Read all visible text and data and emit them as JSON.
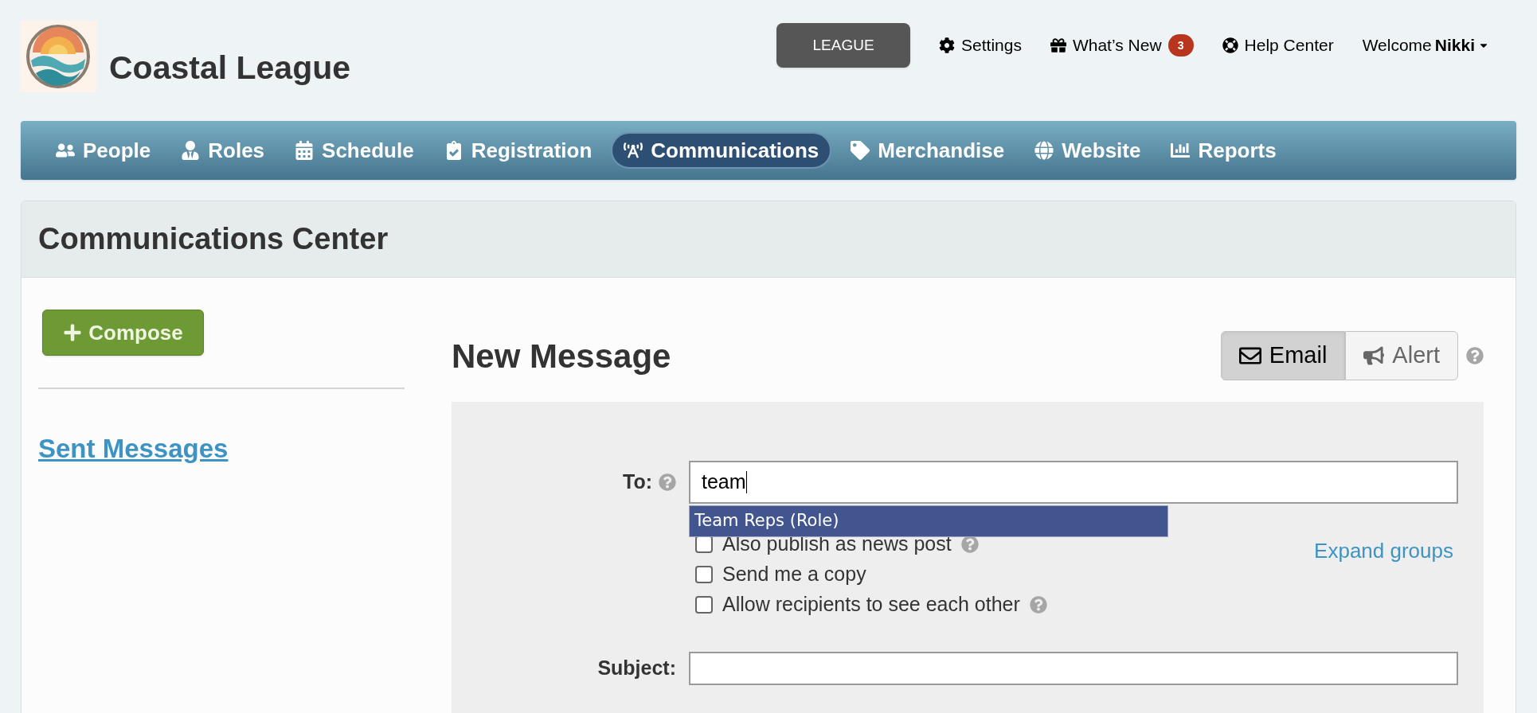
{
  "brand": {
    "name": "Coastal League"
  },
  "top_links": [
    {
      "kind": "button",
      "label": "LEAGUE"
    },
    {
      "kind": "settings",
      "label": "Settings"
    },
    {
      "kind": "gift",
      "label": "What’s New",
      "badge": "3"
    },
    {
      "kind": "help",
      "label": "Help Center"
    },
    {
      "kind": "user",
      "label": "Welcome",
      "user": "Nikki"
    }
  ],
  "nav": [
    {
      "kind": "people",
      "label": "People",
      "selected": false
    },
    {
      "kind": "roles",
      "label": "Roles",
      "selected": false
    },
    {
      "kind": "schedule",
      "label": "Schedule",
      "selected": false
    },
    {
      "kind": "registration",
      "label": "Registration",
      "selected": false
    },
    {
      "kind": "communications",
      "label": "Communications",
      "selected": true
    },
    {
      "kind": "merchandise",
      "label": "Merchandise",
      "selected": false
    },
    {
      "kind": "website",
      "label": "Website",
      "selected": false
    },
    {
      "kind": "reports",
      "label": "Reports",
      "selected": false
    }
  ],
  "panel": {
    "title": "Communications Center"
  },
  "sidebar": {
    "compose": "Compose",
    "links": [
      "Sent Messages"
    ]
  },
  "message": {
    "title": "New Message",
    "modes": [
      {
        "kind": "email",
        "label": "Email",
        "selected": true
      },
      {
        "kind": "alert",
        "label": "Alert",
        "selected": false
      }
    ],
    "to": {
      "label": "To:",
      "value": "team",
      "suggestions": [
        "Team Reps (Role)"
      ]
    },
    "expand_link": "Expand groups",
    "options": [
      {
        "label": "Also publish as news post",
        "checked": false,
        "help": true
      },
      {
        "label": "Send me a copy",
        "checked": false,
        "help": false
      },
      {
        "label": "Allow recipients to see each other",
        "checked": false,
        "help": true
      }
    ],
    "subject": {
      "label": "Subject:"
    }
  }
}
